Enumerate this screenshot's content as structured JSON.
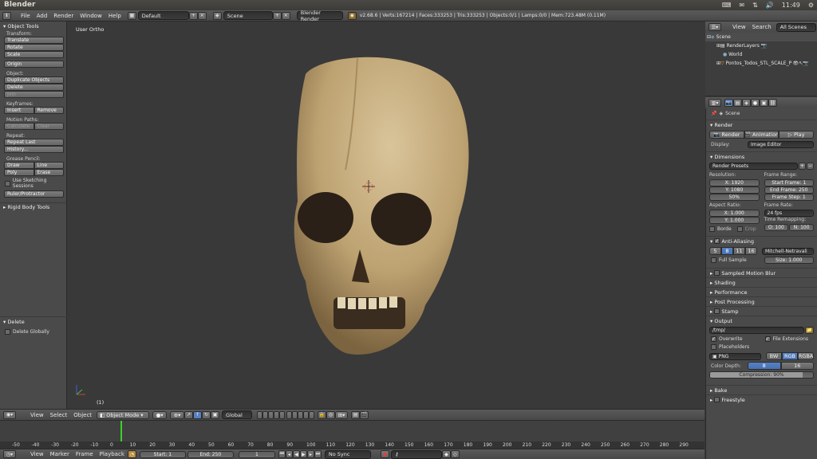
{
  "os": {
    "title": "Blender",
    "time": "11:49",
    "audio_glyph": "🔊"
  },
  "info": {
    "menus": [
      "File",
      "Add",
      "Render",
      "Window",
      "Help"
    ],
    "screen": "Default",
    "scene": "Scene",
    "engine": "Blender Render",
    "stats": "v2.68.6 | Verts:167214 | Faces:333253 | Tris:333253 | Objects:0/1 | Lamps:0/0 | Mem:723.48M (0.11M)"
  },
  "tools": {
    "header": "Object Tools",
    "transform": "Transform:",
    "translate": "Translate",
    "rotate": "Rotate",
    "scale": "Scale",
    "origin": "Origin",
    "object": "Object:",
    "duplicate": "Duplicate Objects",
    "delete": "Delete",
    "join": "Join",
    "keyframes": "Keyframes:",
    "insert": "Insert",
    "remove": "Remove",
    "motion": "Motion Paths:",
    "calculate": "Calculate",
    "clear": "Clear",
    "repeat": "Repeat:",
    "repeat_last": "Repeat Last",
    "history": "History...",
    "grease": "Grease Pencil:",
    "draw": "Draw",
    "line": "Line",
    "poly": "Poly",
    "erase": "Erase",
    "sketching": "Use Sketching Sessions",
    "ruler": "Ruler/Protractor",
    "rigid": "Rigid Body Tools",
    "delete_panel": "Delete",
    "delete_globally": "Delete Globally"
  },
  "viewport": {
    "label": "User Ortho",
    "frame": "(1)"
  },
  "vhead": {
    "view": "View",
    "select": "Select",
    "object": "Object",
    "mode": "Object Mode",
    "orientation": "Global"
  },
  "timeline": {
    "ticks": [
      "-50",
      "-40",
      "-30",
      "-20",
      "-10",
      "0",
      "10",
      "20",
      "30",
      "40",
      "50",
      "60",
      "70",
      "80",
      "90",
      "100",
      "110",
      "120",
      "130",
      "140",
      "150",
      "160",
      "170",
      "180",
      "190",
      "200",
      "210",
      "220",
      "230",
      "240",
      "250",
      "260",
      "270",
      "280",
      "290"
    ]
  },
  "tlhead": {
    "view": "View",
    "marker": "Marker",
    "frame": "Frame",
    "playback": "Playback",
    "start": "Start: 1",
    "end": "End: 250",
    "current": "1",
    "sync": "No Sync"
  },
  "outliner": {
    "view": "View",
    "search": "Search",
    "scenes": "All Scenes",
    "items": [
      "Scene",
      "RenderLayers",
      "World",
      "Pontos_Todos_STL_SCALE_PC"
    ]
  },
  "props": {
    "context": "Scene",
    "render": "Render",
    "render_btn": "Render",
    "animation_btn": "Animation",
    "play_btn": "Play",
    "display": "Display:",
    "display_val": "Image Editor",
    "dimensions": "Dimensions",
    "presets": "Render Presets",
    "resolution": "Resolution:",
    "res_x": "X: 1920",
    "res_y": "Y: 1080",
    "res_pct": "50%",
    "frame_range": "Frame Range:",
    "start_frame": "Start Frame: 1",
    "end_frame": "End Frame: 250",
    "frame_step": "Frame Step: 1",
    "aspect": "Aspect Ratio:",
    "asp_x": "X: 1.000",
    "asp_y": "Y: 1.000",
    "frame_rate": "Frame Rate:",
    "fps": "24 fps",
    "remap": "Time Remapping:",
    "remap_old": "O: 100",
    "remap_new": "N: 100",
    "border": "Borde",
    "crop": "Crop",
    "aa": "Anti-Aliasing",
    "aa_samples": [
      "5",
      "8",
      "11",
      "16"
    ],
    "aa_filter": "Mitchell-Netravali",
    "full_sample": "Full Sample",
    "size": "Size: 1.000",
    "smb": "Sampled Motion Blur",
    "shading": "Shading",
    "performance": "Performance",
    "post": "Post Processing",
    "stamp": "Stamp",
    "output": "Output",
    "path": "/tmp/",
    "overwrite": "Overwrite",
    "file_ext": "File Extensions",
    "placeholders": "Placeholders",
    "format": "PNG",
    "bw": "BW",
    "rgb": "RGB",
    "rgba": "RGBA",
    "depth": "Color Depth:",
    "d8": "8",
    "d16": "16",
    "compression": "Compression: 90%",
    "compression_frac": 0.9,
    "bake": "Bake",
    "freestyle": "Freestyle"
  },
  "colors": {
    "accent": "#5680c2",
    "frame_marker": "#39d12a"
  }
}
